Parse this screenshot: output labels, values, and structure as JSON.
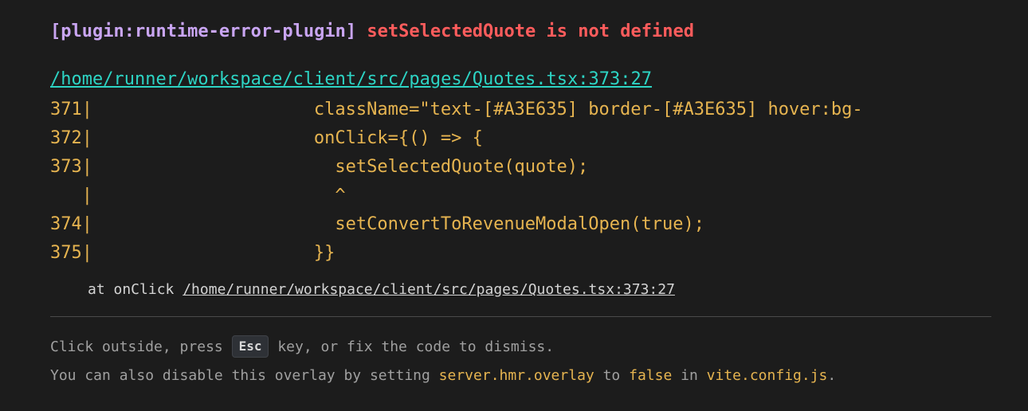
{
  "error": {
    "plugin": "[plugin:runtime-error-plugin]",
    "message": "setSelectedQuote is not defined",
    "file": "/home/runner/workspace/client/src/pages/Quotes.tsx:373:27"
  },
  "frame": [
    {
      "num": "371|",
      "code": "                    className=\"text-[#A3E635] border-[#A3E635] hover:bg-"
    },
    {
      "num": "372|",
      "code": "                    onClick={() => {"
    },
    {
      "num": "373|",
      "code": "                      setSelectedQuote(quote);"
    },
    {
      "num": "   |",
      "code": "                      ^"
    },
    {
      "num": "374|",
      "code": "                      setConvertToRevenueModalOpen(true);"
    },
    {
      "num": "375|",
      "code": "                    }}"
    }
  ],
  "stack": {
    "prefix": "at onClick ",
    "link": "/home/runner/workspace/client/src/pages/Quotes.tsx:373:27"
  },
  "tip": {
    "line1_a": "Click outside, press ",
    "key": "Esc",
    "line1_b": " key, or fix the code to dismiss.",
    "line2_a": "You can also disable this overlay by setting ",
    "config_key": "server.hmr.overlay",
    "line2_b": " to ",
    "false_word": "false",
    "line2_c": " in ",
    "config_file": "vite.config.js",
    "line2_d": "."
  }
}
